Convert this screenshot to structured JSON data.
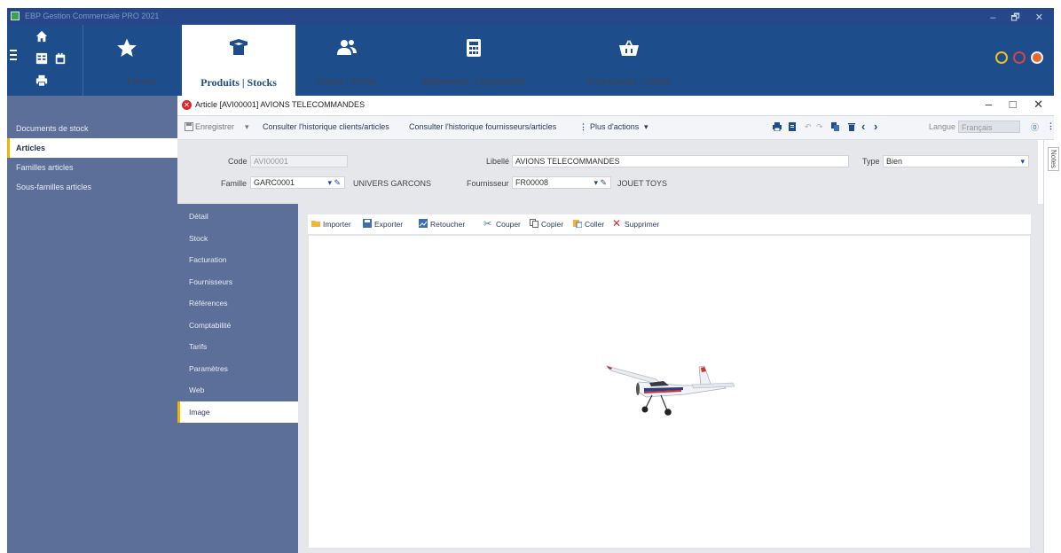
{
  "window": {
    "title": "EBP Gestion Commerciale PRO 2021",
    "controls": [
      "–",
      "🗗",
      "✕"
    ]
  },
  "ribbon": {
    "favorites_label": "Favoris",
    "tabs": [
      {
        "label": "Produits | Stocks",
        "icon": "box-icon",
        "active": true
      },
      {
        "label": "Clients | Ventes",
        "icon": "users-icon",
        "active": false
      },
      {
        "label": "Règlements | Comptabilité",
        "icon": "calculator-icon",
        "active": false
      },
      {
        "label": "Fournisseurs | Achats",
        "icon": "basket-icon",
        "active": false
      }
    ],
    "right_icons": [
      "sync-icon",
      "help-icon",
      "account-icon"
    ],
    "accent": "#1e4d8c"
  },
  "sidebar": {
    "items": [
      {
        "label": "Documents de stock",
        "active": false
      },
      {
        "label": "Articles",
        "active": true
      },
      {
        "label": "Familles articles",
        "active": false
      },
      {
        "label": "Sous-familles articles",
        "active": false
      }
    ]
  },
  "document": {
    "title": "Article [AVI00001] AVIONS TELECOMMANDES",
    "controls": [
      "–",
      "□",
      "✕"
    ]
  },
  "actions": {
    "save": "Enregistrer",
    "hist_clients": "Consulter l'historique clients/articles",
    "hist_suppliers": "Consulter l'historique fournisseurs/articles",
    "more": "Plus d'actions",
    "language_label": "Langue",
    "language_value": "Français"
  },
  "form": {
    "code_label": "Code",
    "code_value": "AVI00001",
    "libelle_label": "Libellé",
    "libelle_value": "AVIONS TELECOMMANDES",
    "type_label": "Type",
    "type_value": "Bien",
    "famille_label": "Famille",
    "famille_value": "GARC0001",
    "famille_desc": "UNIVERS GARCONS",
    "fournisseur_label": "Fournisseur",
    "fournisseur_value": "FR00008",
    "fournisseur_desc": "JOUET TOYS"
  },
  "notes_label": "Notes",
  "tabs": [
    {
      "label": "Détail",
      "active": false
    },
    {
      "label": "Stock",
      "active": false
    },
    {
      "label": "Facturation",
      "active": false
    },
    {
      "label": "Fournisseurs",
      "active": false
    },
    {
      "label": "Références",
      "active": false
    },
    {
      "label": "Comptabilité",
      "active": false
    },
    {
      "label": "Tarifs",
      "active": false
    },
    {
      "label": "Paramètres",
      "active": false
    },
    {
      "label": "Web",
      "active": false
    },
    {
      "label": "Image",
      "active": true
    }
  ],
  "image_toolbar": {
    "import": "Importer",
    "export": "Exporter",
    "retouch": "Retoucher",
    "cut": "Couper",
    "copy": "Copier",
    "paste": "Coller",
    "delete": "Supprimer"
  }
}
